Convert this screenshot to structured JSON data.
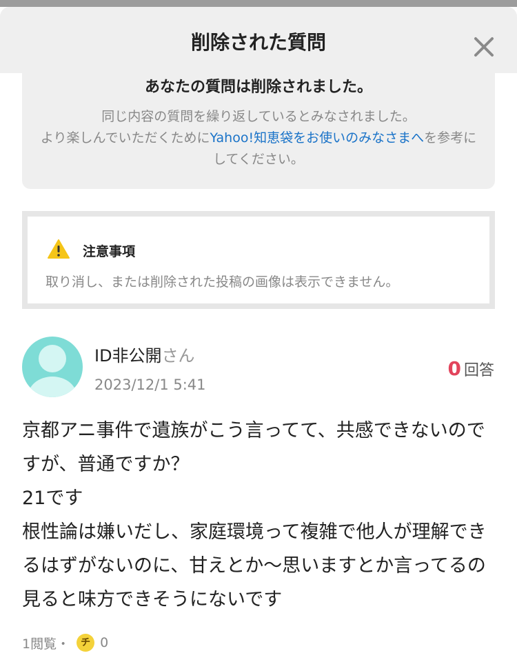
{
  "header": {
    "title": "削除された質問",
    "close_icon": "close-icon"
  },
  "notice": {
    "heading": "あなたの質問は削除されました。",
    "line1": "同じ内容の質問を繰り返しているとみなされました。",
    "line2_prefix": "より楽しんでいただくために",
    "link_text": "Yahoo!知恵袋をお使いのみなさまへ",
    "line2_suffix": "を参考にしてください。"
  },
  "caution": {
    "icon": "warning-icon",
    "title": "注意事項",
    "text": "取り消し、または削除された投稿の画像は表示できません。"
  },
  "question": {
    "avatar_icon": "user-avatar-icon",
    "user_name": "ID非公開",
    "user_suffix": "さん",
    "date": "2023/12/1 5:41",
    "answer_count": "0",
    "answer_label": "回答",
    "body": "京都アニ事件で遺族がこう言ってて、共感できないのですが、普通ですか？\n21です\n根性論は嫌いだし、家庭環境って複雑で他人が理解できるはずがないのに、甘えとか〜思いますとか言ってるの見ると味方できそうにないです",
    "views": "1閲覧",
    "separator": "・",
    "coin_icon": "chie-coin-icon",
    "coin_symbol": "チ",
    "coin_count": "0"
  },
  "colors": {
    "header_bg": "#efefef",
    "link": "#1a73c8",
    "answer_count": "#e2445c",
    "avatar": "#7edcd6",
    "warning": "#f5c518"
  }
}
